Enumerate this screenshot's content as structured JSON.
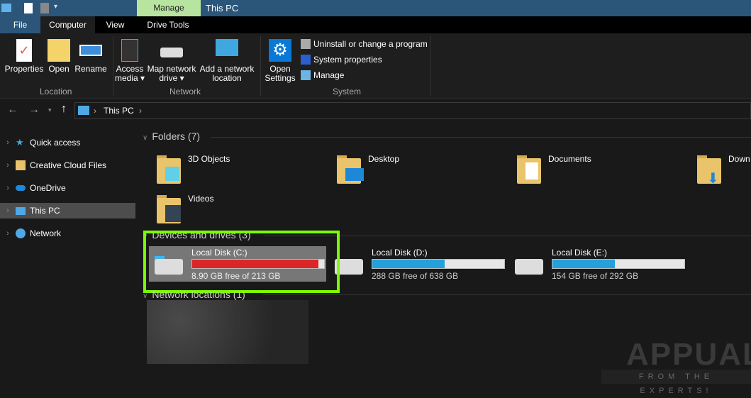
{
  "titlebar": {
    "context_tab": "Manage",
    "title": "This PC"
  },
  "tabs": [
    {
      "label": "File"
    },
    {
      "label": "Computer"
    },
    {
      "label": "View"
    },
    {
      "label": "Drive Tools"
    }
  ],
  "ribbon": {
    "location": {
      "label": "Location",
      "buttons": [
        {
          "label": "Properties"
        },
        {
          "label": "Open"
        },
        {
          "label": "Rename"
        }
      ]
    },
    "network": {
      "label": "Network",
      "buttons": [
        {
          "label": "Access media ▾"
        },
        {
          "label": "Map network drive ▾"
        },
        {
          "label": "Add a network location"
        }
      ]
    },
    "system": {
      "label": "System",
      "open_settings": "Open Settings",
      "items": [
        {
          "label": "Uninstall or change a program"
        },
        {
          "label": "System properties"
        },
        {
          "label": "Manage"
        }
      ]
    }
  },
  "address": {
    "crumb": "This PC"
  },
  "nav": [
    {
      "label": "Quick access",
      "icon": "star-icon"
    },
    {
      "label": "Creative Cloud Files",
      "icon": "creative-cloud-icon"
    },
    {
      "label": "OneDrive",
      "icon": "cloud-icon"
    },
    {
      "label": "This PC",
      "icon": "computer-icon",
      "selected": true
    },
    {
      "label": "Network",
      "icon": "network-icon"
    }
  ],
  "folders": {
    "header": "Folders (7)",
    "items": [
      {
        "label": "3D Objects"
      },
      {
        "label": "Desktop"
      },
      {
        "label": "Documents"
      },
      {
        "label": "Down"
      },
      {
        "label": "Videos"
      }
    ]
  },
  "drives": {
    "header": "Devices and drives (3)",
    "items": [
      {
        "name": "Local Disk (C:)",
        "free": "8.90 GB free of 213 GB",
        "used_fraction": 0.958,
        "color": "#da2626"
      },
      {
        "name": "Local Disk (D:)",
        "free": "288 GB free of 638 GB",
        "used_fraction": 0.549,
        "color": "#26a0da"
      },
      {
        "name": "Local Disk (E:)",
        "free": "154 GB free of 292 GB",
        "used_fraction": 0.473,
        "color": "#26a0da"
      }
    ]
  },
  "network_locations": {
    "header": "Network locations (1)"
  },
  "watermark": {
    "text": "APPUALS",
    "tagline": "FROM THE EXPERTS!"
  },
  "colors": {
    "highlight": "#7cfc00",
    "selection": "#777777"
  }
}
